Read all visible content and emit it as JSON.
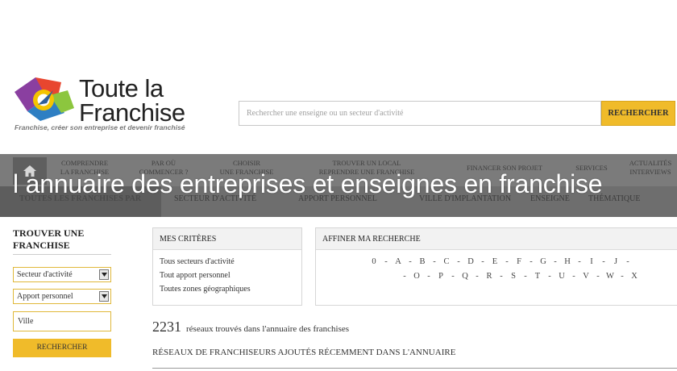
{
  "logo": {
    "line1": "Toute la",
    "line2": "Franchise",
    "tagline": "Franchise, créer son entreprise et devenir franchisé"
  },
  "search": {
    "placeholder": "Rechercher une enseigne ou un secteur d'activité",
    "button_label": "RECHERCHER"
  },
  "nav": {
    "home_icon": "home-icon",
    "top_items": [
      {
        "line1": "COMPRENDRE",
        "line2": "LA FRANCHISE"
      },
      {
        "line1": "PAR OÙ",
        "line2": "COMMENCER ?"
      },
      {
        "line1": "CHOISIR",
        "line2": "UNE FRANCHISE"
      },
      {
        "line1": "TROUVER UN LOCAL",
        "line2": "REPRENDRE UNE FRANCHISE"
      },
      {
        "line1": "FINANCER SON PROJET",
        "line2": ""
      },
      {
        "line1": "SERVICES",
        "line2": ""
      },
      {
        "line1": "ACTUALITÉS",
        "line2": "INTERVIEWS"
      }
    ],
    "sub_first": "TOUTES LES FRANCHISES PAR",
    "sub_items": [
      "SECTEUR D'ACTIVITÉ",
      "APPORT PERSONNEL",
      "VILLE D'IMPLANTATION",
      "ENSEIGNE",
      "THÉMATIQUE"
    ]
  },
  "page_title": "l annuaire des entreprises et enseignes en franchise",
  "sidebar": {
    "title": "TROUVER UNE FRANCHISE",
    "select_sector": "Secteur d'activité",
    "select_apport": "Apport personnel",
    "ville_placeholder": "Ville",
    "button_label": "RECHERCHER"
  },
  "criteria": {
    "title": "MES CRITÈRES",
    "items": [
      "Tous secteurs d'activité",
      "Tout apport personnel",
      "Toutes zones géographiques"
    ]
  },
  "refine": {
    "title": "AFFINER MA RECHERCHE",
    "row1": [
      "0",
      "A",
      "B",
      "C",
      "D",
      "E",
      "F",
      "G",
      "H",
      "I",
      "J"
    ],
    "row2": [
      "O",
      "P",
      "Q",
      "R",
      "S",
      "T",
      "U",
      "V",
      "W",
      "X"
    ]
  },
  "results": {
    "count": "2231",
    "count_text": "réseaux trouvés dans l'annuaire des franchises",
    "recent_heading": "RÉSEAUX DE FRANCHISEURS AJOUTÉS RÉCEMMENT DANS L'ANNUAIRE"
  },
  "colors": {
    "accent": "#f0bb2a",
    "nav_bg": "#7b7b7b"
  }
}
